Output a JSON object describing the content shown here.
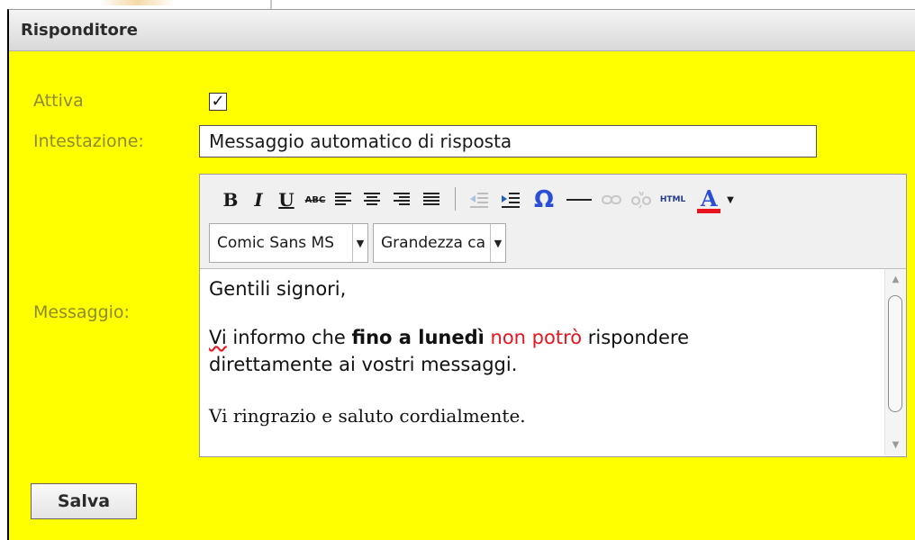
{
  "panel": {
    "title": "Risponditore"
  },
  "form": {
    "active_label": "Attiva",
    "active_checked": true,
    "active_mark": "✓",
    "subject_label": "Intestazione:",
    "subject_value": "Messaggio automatico di risposta",
    "message_label": "Messaggio:"
  },
  "toolbar": {
    "bold": "B",
    "italic": "I",
    "underline": "U",
    "strikethrough": "ABC",
    "special_char": "Ω",
    "html": "HTML",
    "font_color": "A",
    "font_family": "Comic Sans MS",
    "font_size": "Grandezza caratteri"
  },
  "message": {
    "p1": "Gentili signori,",
    "p2_part1": "Vi",
    "p2_part2": " informo che ",
    "p2_bold": "fino a lunedì",
    "p2_red": "non potrò",
    "p2_part3": " rispondere",
    "p2_line2": "direttamente ai vostri messaggi.",
    "p3": "Vi ringrazio e saluto cordialmente."
  },
  "actions": {
    "save_label": "Salva"
  },
  "colors": {
    "panel_bg": "#ffff00",
    "label_color": "#8c8a2a",
    "red_text": "#e8141e",
    "font_color_bar": "#e8141e",
    "omega_blue": "#2a4fd6"
  }
}
